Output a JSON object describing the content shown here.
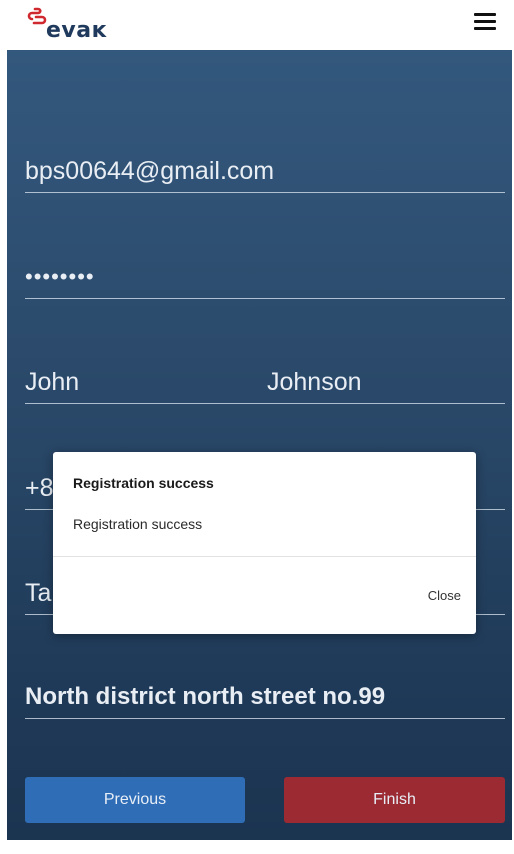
{
  "header": {
    "logo_text": "evaĸ",
    "logo_icon": "evak-logo-icon",
    "menu_icon": "hamburger-menu-icon"
  },
  "form": {
    "email": "bps00644@gmail.com",
    "password": "••••••••",
    "first_name": "John",
    "last_name": "Johnson",
    "phone_partial": "+8",
    "city_partial": "Ta",
    "address": "North district north street no.99"
  },
  "buttons": {
    "previous": "Previous",
    "finish": "Finish"
  },
  "modal": {
    "title": "Registration success",
    "message": "Registration success",
    "close": "Close"
  },
  "colors": {
    "panel": "#2b4a6b",
    "previous_button": "#2f6db7",
    "finish_button": "#9b2a33",
    "logo_accent": "#d0282f",
    "logo_text": "#1f3a5c"
  }
}
